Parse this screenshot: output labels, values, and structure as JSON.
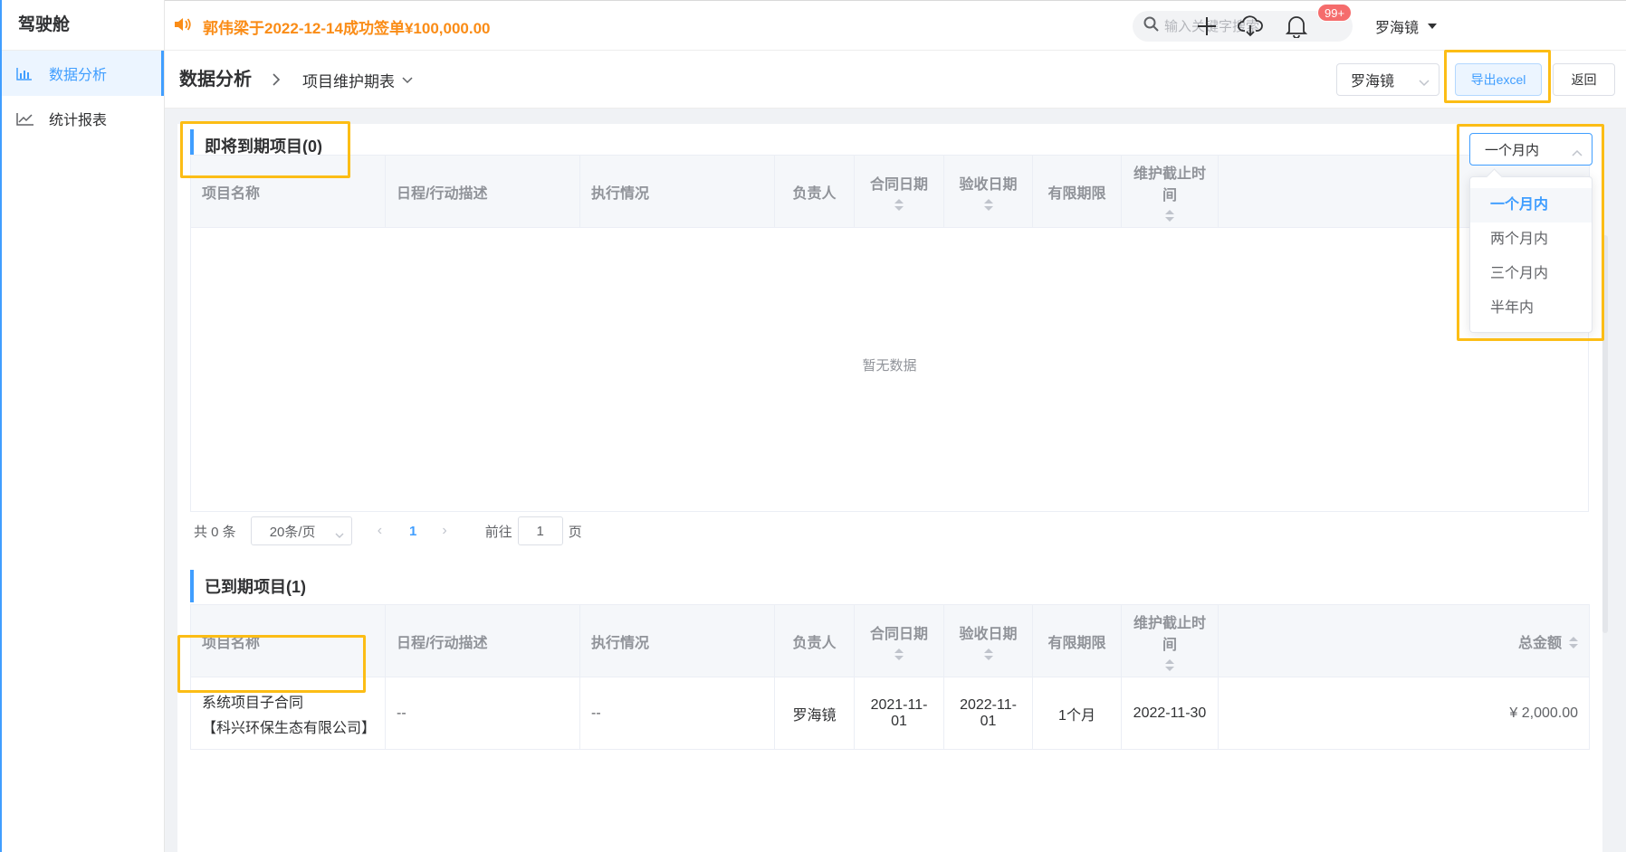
{
  "sidebar": {
    "brand": "驾驶舱",
    "items": [
      {
        "label": "数据分析",
        "icon": "bar-chart-icon",
        "active": true
      },
      {
        "label": "统计报表",
        "icon": "line-chart-icon",
        "active": false
      }
    ]
  },
  "header": {
    "notice": "郭伟梁于2022-12-14成功签单¥100,000.00",
    "search_placeholder": "输入关键字搜索",
    "badge": "99+",
    "user": "罗海镜"
  },
  "breadcrumb": {
    "title": "数据分析",
    "sub": "项目维护期表"
  },
  "toolbar": {
    "user_select": "罗海镜",
    "export_label": "导出excel",
    "back_label": "返回"
  },
  "period": {
    "selected": "一个月内",
    "options": [
      "一个月内",
      "两个月内",
      "三个月内",
      "半年内"
    ]
  },
  "upcoming": {
    "title": "即将到期项目(0)",
    "empty_text": "暂无数据",
    "columns": [
      "项目名称",
      "日程/行动描述",
      "执行情况",
      "负责人",
      "合同日期",
      "验收日期",
      "有限期限",
      "维护截止时间"
    ]
  },
  "pagination": {
    "total": "共 0 条",
    "page_size": "20条/页",
    "current_page": "1",
    "goto_label": "前往",
    "goto_value": "1",
    "goto_unit": "页"
  },
  "expired": {
    "title": "已到期项目(1)",
    "columns": [
      "项目名称",
      "日程/行动描述",
      "执行情况",
      "负责人",
      "合同日期",
      "验收日期",
      "有限期限",
      "维护截止时间",
      "总金额"
    ],
    "rows": [
      {
        "name_line1": "系统项目子合同",
        "name_line2": "【科兴环保生态有限公司】",
        "desc": "--",
        "status": "--",
        "owner": "罗海镜",
        "contract_date": "2021-11-01",
        "accept_date": "2022-11-01",
        "period": "1个月",
        "deadline": "2022-11-30",
        "amount": "¥ 2,000.00"
      }
    ]
  },
  "colors": {
    "accent": "#409eff",
    "notice": "#fa8c16",
    "amount": "#fa6400",
    "highlight": "#fcbd15",
    "badge": "#f56c6c"
  }
}
